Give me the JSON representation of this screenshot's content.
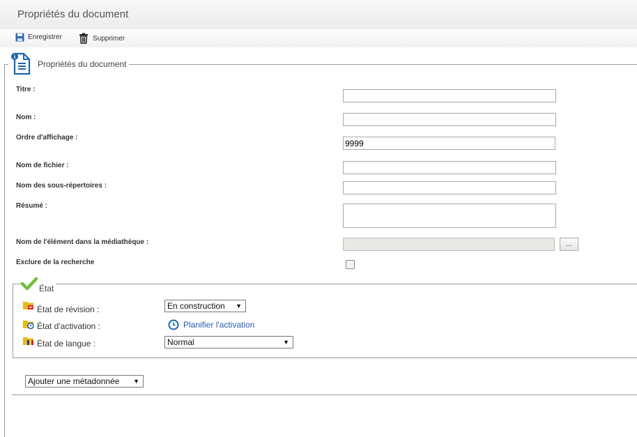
{
  "window": {
    "title": "Propriétés du document"
  },
  "toolbar": {
    "save_label": "Enregistrer",
    "delete_label": "Supprimer"
  },
  "fieldset": {
    "legend": "Propriétés du document"
  },
  "form": {
    "titre": {
      "label": "Titre :",
      "value": ""
    },
    "nom": {
      "label": "Nom :",
      "value": ""
    },
    "ordre": {
      "label": "Ordre d'affichage :",
      "value": "9999"
    },
    "fichier": {
      "label": "Nom de fichier :",
      "value": ""
    },
    "sousrep": {
      "label": "Nom des sous-répertoires :",
      "value": ""
    },
    "resume": {
      "label": "Résumé :",
      "value": ""
    },
    "mediatheque": {
      "label": "Nom de l'élément dans la médiathèque :",
      "value": "",
      "browse_label": "..."
    },
    "exclure": {
      "label": "Exclure de la recherche",
      "checked": false
    }
  },
  "etat": {
    "legend": "État",
    "revision": {
      "label": "État de révision :",
      "selected": "En construction"
    },
    "activation": {
      "label": "État d'activation :",
      "link": "Planifier l'activation"
    },
    "langue": {
      "label": "État de langue :",
      "selected": "Normal"
    }
  },
  "metadata": {
    "selected": "Ajouter une métadonnée"
  },
  "icons": [
    "save-icon",
    "trash-icon",
    "document-info-icon",
    "checkmark-icon",
    "folder-revision-icon",
    "folder-clock-icon",
    "folder-flag-icon",
    "clock-icon"
  ],
  "colors": {
    "accent": "#2a5db0",
    "check": "#6fbf3a",
    "folder": "#e8b91c"
  }
}
